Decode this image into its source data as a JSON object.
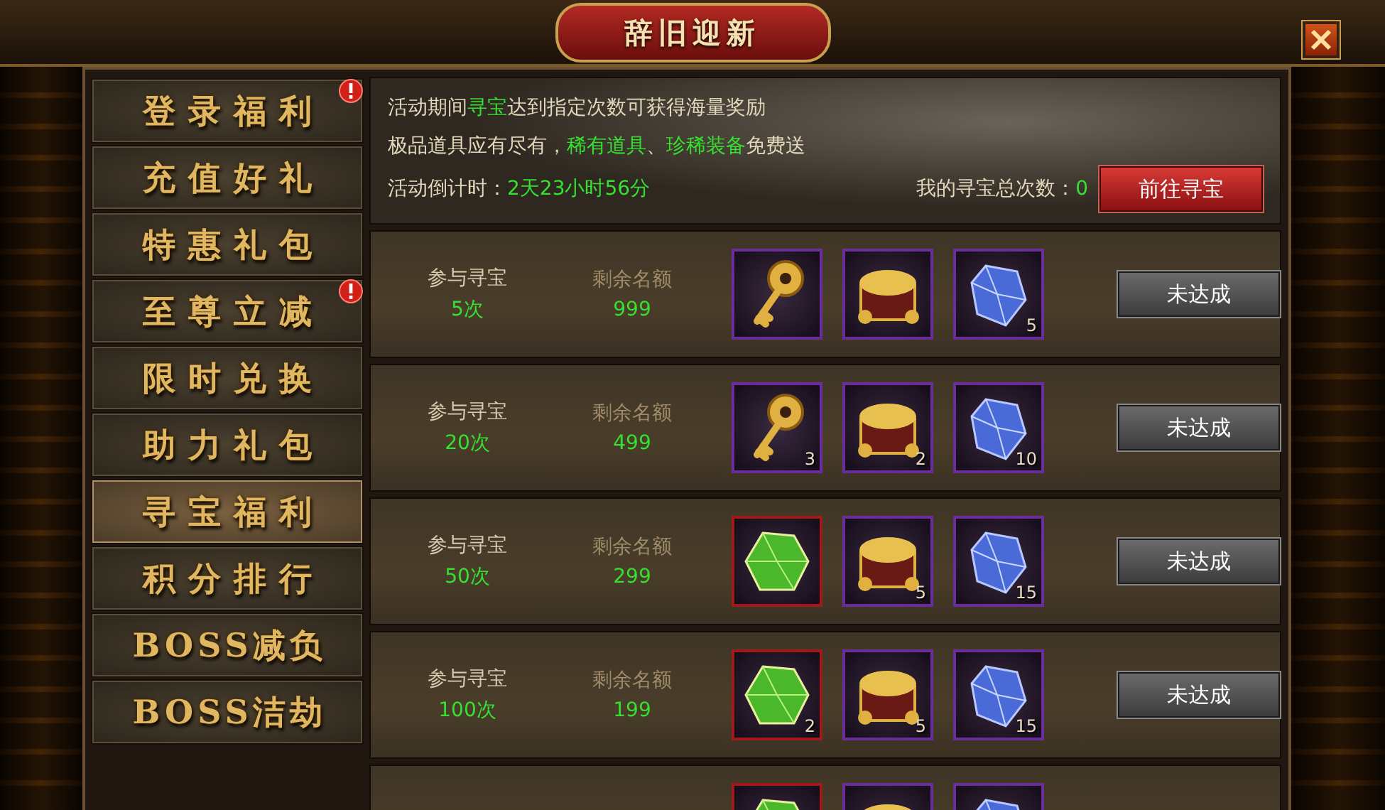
{
  "window": {
    "title": "辞旧迎新"
  },
  "sidebar": {
    "items": [
      {
        "label": "登录福利",
        "selected": false,
        "alert": true
      },
      {
        "label": "充值好礼",
        "selected": false,
        "alert": false
      },
      {
        "label": "特惠礼包",
        "selected": false,
        "alert": false
      },
      {
        "label": "至尊立减",
        "selected": false,
        "alert": true
      },
      {
        "label": "限时兑换",
        "selected": false,
        "alert": false
      },
      {
        "label": "助力礼包",
        "selected": false,
        "alert": false
      },
      {
        "label": "寻宝福利",
        "selected": true,
        "alert": false
      },
      {
        "label": "积分排行",
        "selected": false,
        "alert": false
      },
      {
        "label": "BOSS减负",
        "selected": false,
        "alert": false
      },
      {
        "label": "BOSS洁劫",
        "selected": false,
        "alert": false
      }
    ]
  },
  "banner": {
    "lines": [
      [
        {
          "text": "活动期间",
          "highlight": false
        },
        {
          "text": "寻宝",
          "highlight": true
        },
        {
          "text": "达到指定次数可获得海量奖励",
          "highlight": false
        }
      ],
      [
        {
          "text": "极品道具应有尽有，",
          "highlight": false
        },
        {
          "text": "稀有道具",
          "highlight": true
        },
        {
          "text": "、",
          "highlight": false
        },
        {
          "text": "珍稀装备",
          "highlight": true
        },
        {
          "text": "免费送",
          "highlight": false
        }
      ]
    ],
    "countdown_label": "活动倒计时：",
    "countdown": "2天23小时56分",
    "total_label": "我的寻宝总次数：",
    "total": "0",
    "button": "前往寻宝"
  },
  "rows": [
    {
      "label_1": "参与寻宝",
      "value_1": "5次",
      "label_2": "剩余名额",
      "value_2": "999",
      "button": "未达成",
      "achieved": false,
      "items": [
        {
          "kind": "key",
          "color": "#6b2c9c"
        },
        {
          "kind": "chest",
          "color": "#6b2c9c"
        },
        {
          "kind": "crystal",
          "color": "#6b2c9c",
          "count": "5"
        }
      ]
    },
    {
      "label_1": "参与寻宝",
      "value_1": "20次",
      "label_2": "剩余名额",
      "value_2": "499",
      "button": "未达成",
      "achieved": false,
      "items": [
        {
          "kind": "key",
          "color": "#6b2c9c",
          "count": "3"
        },
        {
          "kind": "chest",
          "color": "#6b2c9c",
          "count": "2"
        },
        {
          "kind": "crystal",
          "color": "#6b2c9c",
          "count": "10"
        }
      ]
    },
    {
      "label_1": "参与寻宝",
      "value_1": "50次",
      "label_2": "剩余名额",
      "value_2": "299",
      "button": "未达成",
      "achieved": false,
      "items": [
        {
          "kind": "gem",
          "color": "#a11a1a"
        },
        {
          "kind": "chest",
          "color": "#6b2c9c",
          "count": "5"
        },
        {
          "kind": "crystal",
          "color": "#6b2c9c",
          "count": "15"
        }
      ]
    },
    {
      "label_1": "参与寻宝",
      "value_1": "100次",
      "label_2": "剩余名额",
      "value_2": "199",
      "button": "未达成",
      "achieved": false,
      "items": [
        {
          "kind": "gem",
          "color": "#a11a1a",
          "count": "2"
        },
        {
          "kind": "chest",
          "color": "#6b2c9c",
          "count": "5"
        },
        {
          "kind": "crystal",
          "color": "#6b2c9c",
          "count": "15"
        }
      ]
    },
    {
      "items": [
        {
          "kind": "gem",
          "color": "#a11a1a"
        },
        {
          "kind": "chest",
          "color": "#6b2c9c"
        },
        {
          "kind": "crystal",
          "color": "#6b2c9c"
        }
      ]
    }
  ]
}
